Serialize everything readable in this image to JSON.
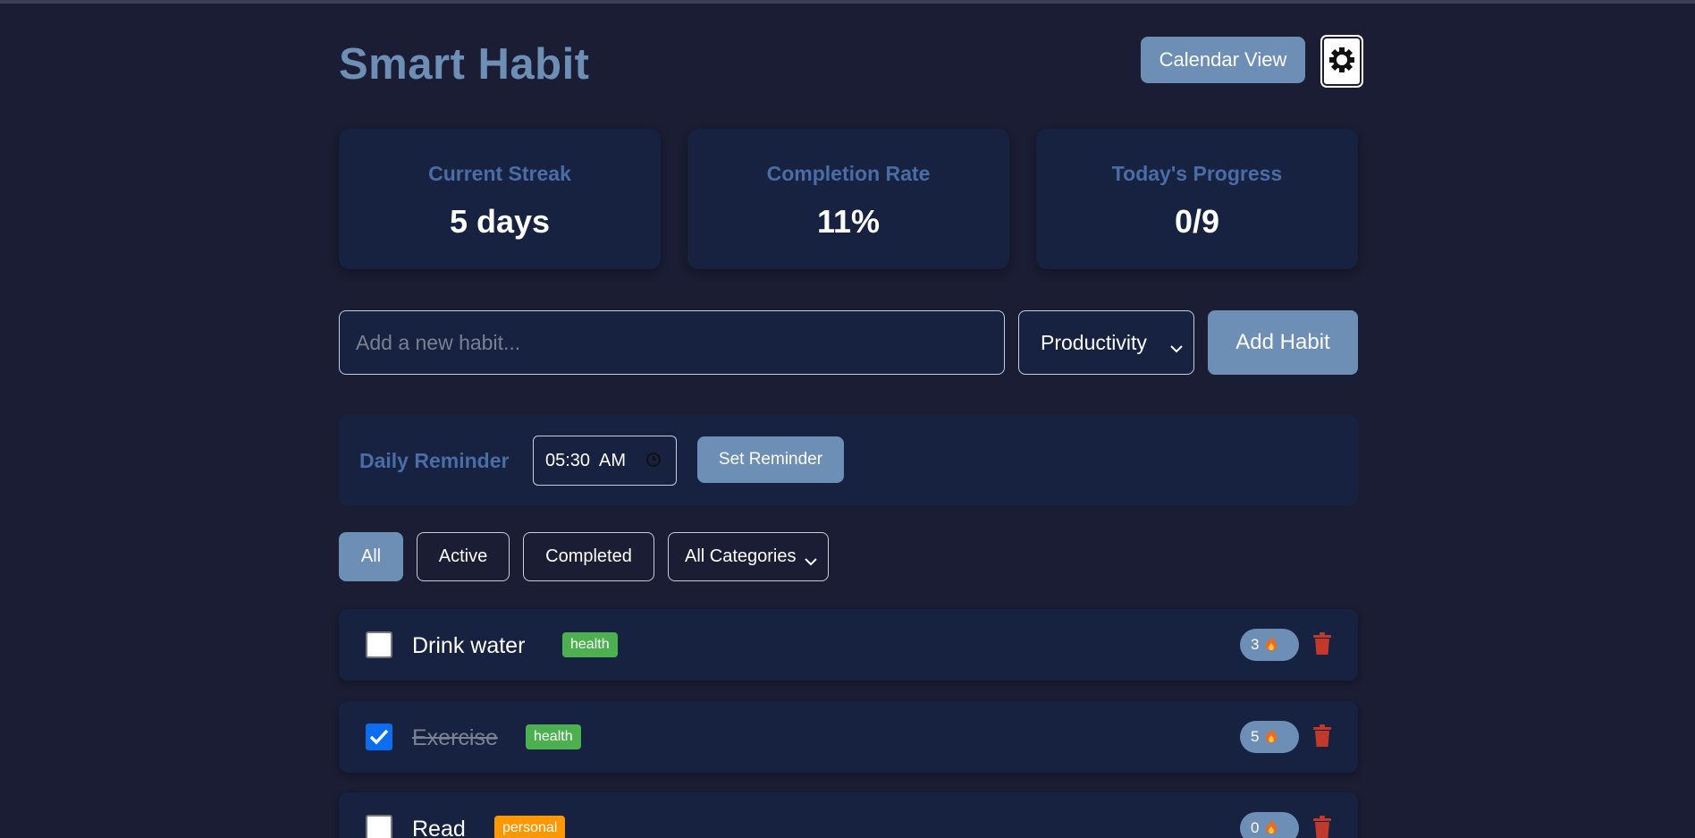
{
  "header": {
    "title": "Smart Habit",
    "calendar_button": "Calendar View",
    "theme_icon": "gear-icon"
  },
  "stats": [
    {
      "label": "Current Streak",
      "value": "5 days"
    },
    {
      "label": "Completion Rate",
      "value": "11%"
    },
    {
      "label": "Today's Progress",
      "value": "0/9"
    }
  ],
  "add_habit": {
    "placeholder": "Add a new habit...",
    "category": "Productivity",
    "button": "Add Habit"
  },
  "reminder": {
    "label": "Daily Reminder",
    "time": "05:30  AM",
    "button": "Set Reminder"
  },
  "filters": {
    "buttons": [
      "All",
      "Active",
      "Completed"
    ],
    "active": "All",
    "category": "All Categories"
  },
  "habits": [
    {
      "name": "Drink water",
      "tag": "health",
      "tag_color": "#4caf50",
      "checked": false,
      "streak": "3"
    },
    {
      "name": "Exercise",
      "tag": "health",
      "tag_color": "#4caf50",
      "checked": true,
      "streak": "5"
    },
    {
      "name": "Read",
      "tag": "personal",
      "tag_color": "#ff9800",
      "checked": false,
      "streak": "0"
    }
  ],
  "colors": {
    "background": "#1a1d33",
    "card": "#172140",
    "accent": "#6d8eb5",
    "label": "#4a6da6",
    "delete": "#c0392b"
  }
}
